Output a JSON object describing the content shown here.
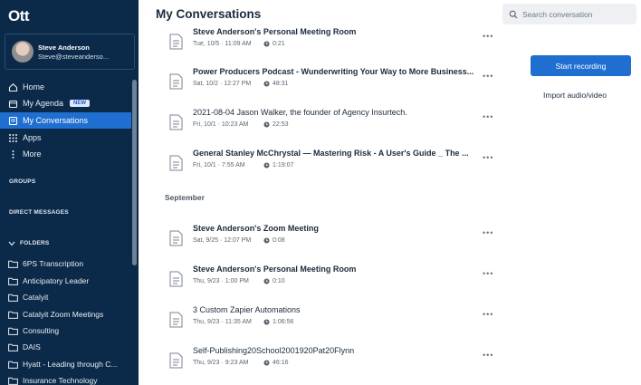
{
  "brand": {
    "logo_text": "Ott"
  },
  "user": {
    "name": "Steve Anderson",
    "email": "Steve@steveanderso..."
  },
  "nav": {
    "home": "Home",
    "agenda": "My Agenda",
    "agenda_badge": "NEW",
    "conversations": "My Conversations",
    "apps": "Apps",
    "more": "More"
  },
  "sections": {
    "groups": "GROUPS",
    "direct": "DIRECT MESSAGES",
    "folders": "FOLDERS"
  },
  "folders": [
    "6PS Transcription",
    "Anticipatory Leader",
    "Catalyit",
    "Catalyit Zoom Meetings",
    "Consulting",
    "DAIS",
    "Hyatt - Leading through C...",
    "Insurance Technology"
  ],
  "header": {
    "title": "My Conversations",
    "search_placeholder": "Search conversation"
  },
  "actions": {
    "start_recording": "Start recording",
    "import": "Import audio/video"
  },
  "month_label": "September",
  "conversations": [
    {
      "title": "Steve Anderson's Personal Meeting Room",
      "date": "Tue, 10/5 · 11:09 AM",
      "duration": "0:21",
      "bold": true
    },
    {
      "title": "Power Producers Podcast - Wunderwriting Your Way to More Business...",
      "date": "Sat, 10/2 · 12:27 PM",
      "duration": "48:31",
      "bold": true
    },
    {
      "title": "2021-08-04 Jason Walker, the founder of Agency Insurtech.",
      "date": "Fri, 10/1 · 10:23 AM",
      "duration": "22:53",
      "bold": false
    },
    {
      "title": "General Stanley McChrystal — Mastering Risk - A User's Guide _ The ...",
      "date": "Fri, 10/1 · 7:55 AM",
      "duration": "1:19:07",
      "bold": true
    },
    {
      "title": "Steve Anderson's Zoom Meeting",
      "date": "Sat, 9/25 · 12:07 PM",
      "duration": "0:08",
      "bold": true
    },
    {
      "title": "Steve Anderson's Personal Meeting Room",
      "date": "Thu, 9/23 · 1:00 PM",
      "duration": "0:10",
      "bold": true
    },
    {
      "title": "3 Custom Zapier Automations",
      "date": "Thu, 9/23 · 11:35 AM",
      "duration": "1:06:56",
      "bold": false
    },
    {
      "title": "Self-Publishing20School2001920Pat20Flynn",
      "date": "Thu, 9/23 · 9:23 AM",
      "duration": "46:16",
      "bold": false
    }
  ],
  "more_glyph": "•••"
}
